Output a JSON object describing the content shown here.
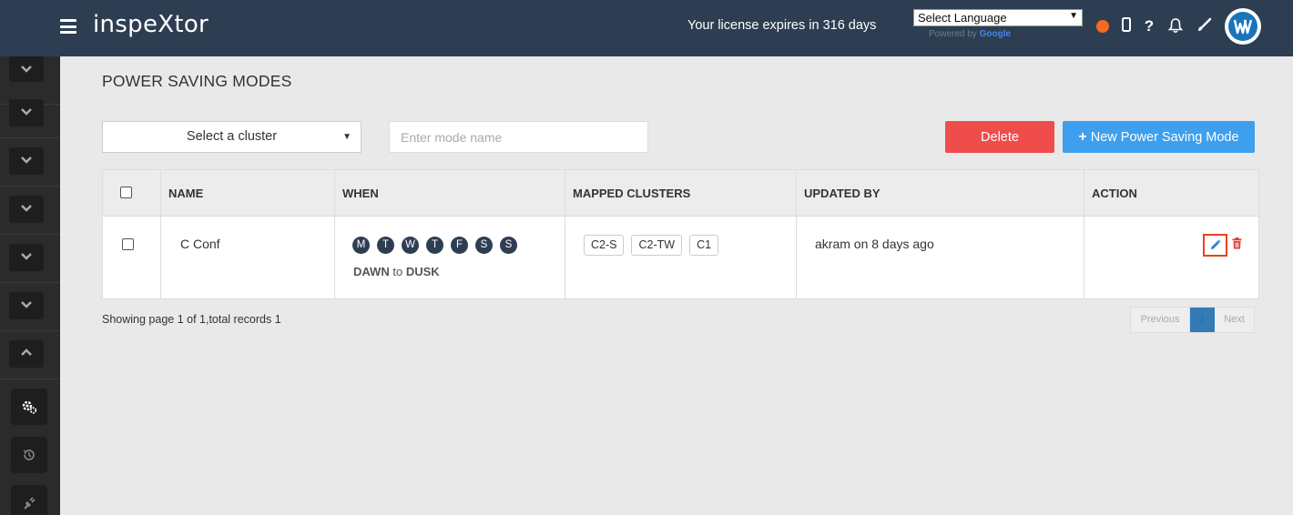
{
  "header": {
    "brand": "inspeXtor",
    "license_text": "Your license expires in 316 days",
    "language_select": "Select Language",
    "powered_by": "Powered by",
    "google": "Google",
    "icons": [
      "status-dot-icon",
      "mobile-icon",
      "help-icon",
      "bell-icon",
      "brush-icon",
      "avatar-logo"
    ],
    "status_color": "#f26b21"
  },
  "sidebar": {
    "items": [
      "chevron-down-icon",
      "chevron-down-icon",
      "chevron-down-icon",
      "chevron-down-icon",
      "chevron-down-icon",
      "chevron-down-icon",
      "chevron-up-icon",
      "gears-icon",
      "history-icon",
      "plug-icon"
    ]
  },
  "page": {
    "title": "POWER SAVING MODES",
    "cluster_select": "Select a cluster",
    "mode_name_placeholder": "Enter mode name",
    "delete_label": "Delete",
    "new_label": "New Power Saving Mode"
  },
  "table": {
    "columns": [
      "NAME",
      "WHEN",
      "MAPPED CLUSTERS",
      "UPDATED BY",
      "ACTION"
    ],
    "rows": [
      {
        "name": "C Conf",
        "days": [
          "M",
          "T",
          "W",
          "T",
          "F",
          "S",
          "S"
        ],
        "when_from": "DAWN",
        "when_to_word": "to",
        "when_to": "DUSK",
        "clusters": [
          "C2-S",
          "C2-TW",
          "C1"
        ],
        "updated_by": "akram on 8 days ago"
      }
    ]
  },
  "footer": {
    "info": "Showing page 1 of 1,total records 1",
    "previous": "Previous",
    "page": "1",
    "next": "Next"
  }
}
